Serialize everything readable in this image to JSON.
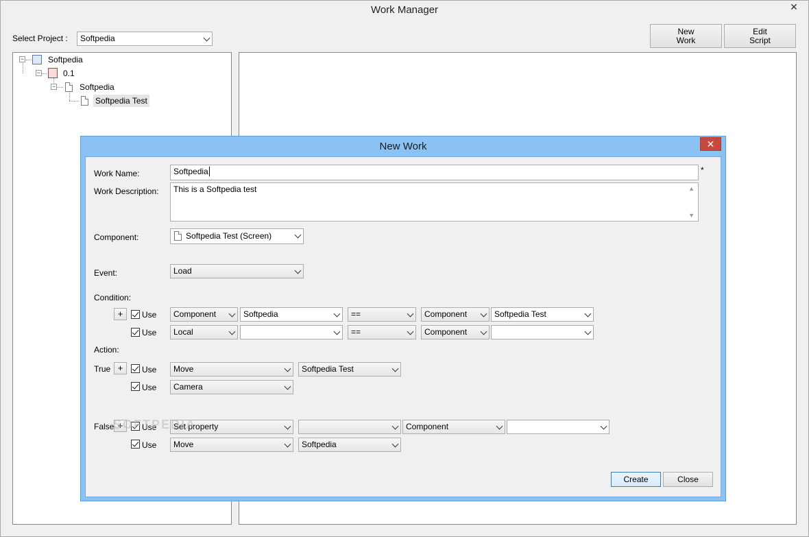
{
  "window": {
    "title": "Work Manager",
    "close_glyph": "✕"
  },
  "toolbar": {
    "project_label": "Select Project :",
    "project_value": "Softpedia",
    "new_work_line1": "New",
    "new_work_line2": "Work",
    "edit_script_line1": "Edit",
    "edit_script_line2": "Script"
  },
  "tree": {
    "root": "Softpedia",
    "version": "0.1",
    "folder": "Softpedia",
    "leaf": "Softpedia Test"
  },
  "dialog": {
    "title": "New Work",
    "close_glyph": "✕",
    "work_name_label": "Work Name:",
    "work_name_value": "Softpedia",
    "required_mark": "*",
    "work_description_label": "Work Description:",
    "work_description_value": "This is a Softpedia test",
    "component_label": "Component:",
    "component_value": "Softpedia Test (Screen)",
    "event_label": "Event:",
    "event_value": "Load",
    "condition_label": "Condition:",
    "action_label": "Action:",
    "true_label": "True",
    "false_label": "False",
    "use_label": "Use",
    "plus_glyph": "+",
    "conditions": [
      {
        "source": "Component",
        "left": "Softpedia",
        "op": "==",
        "target": "Component",
        "right": "Softpedia Test"
      },
      {
        "source": "Local",
        "left": "",
        "op": "==",
        "target": "Component",
        "right": ""
      }
    ],
    "true_actions": [
      {
        "action": "Move",
        "target": "Softpedia Test"
      },
      {
        "action": "Camera"
      }
    ],
    "false_actions": [
      {
        "action": "Set property",
        "target": "",
        "kind": "Component",
        "value": ""
      },
      {
        "action": "Move",
        "target": "Softpedia"
      }
    ],
    "create_label": "Create",
    "close_label": "Close",
    "watermark": "SOFTPEDIA"
  }
}
